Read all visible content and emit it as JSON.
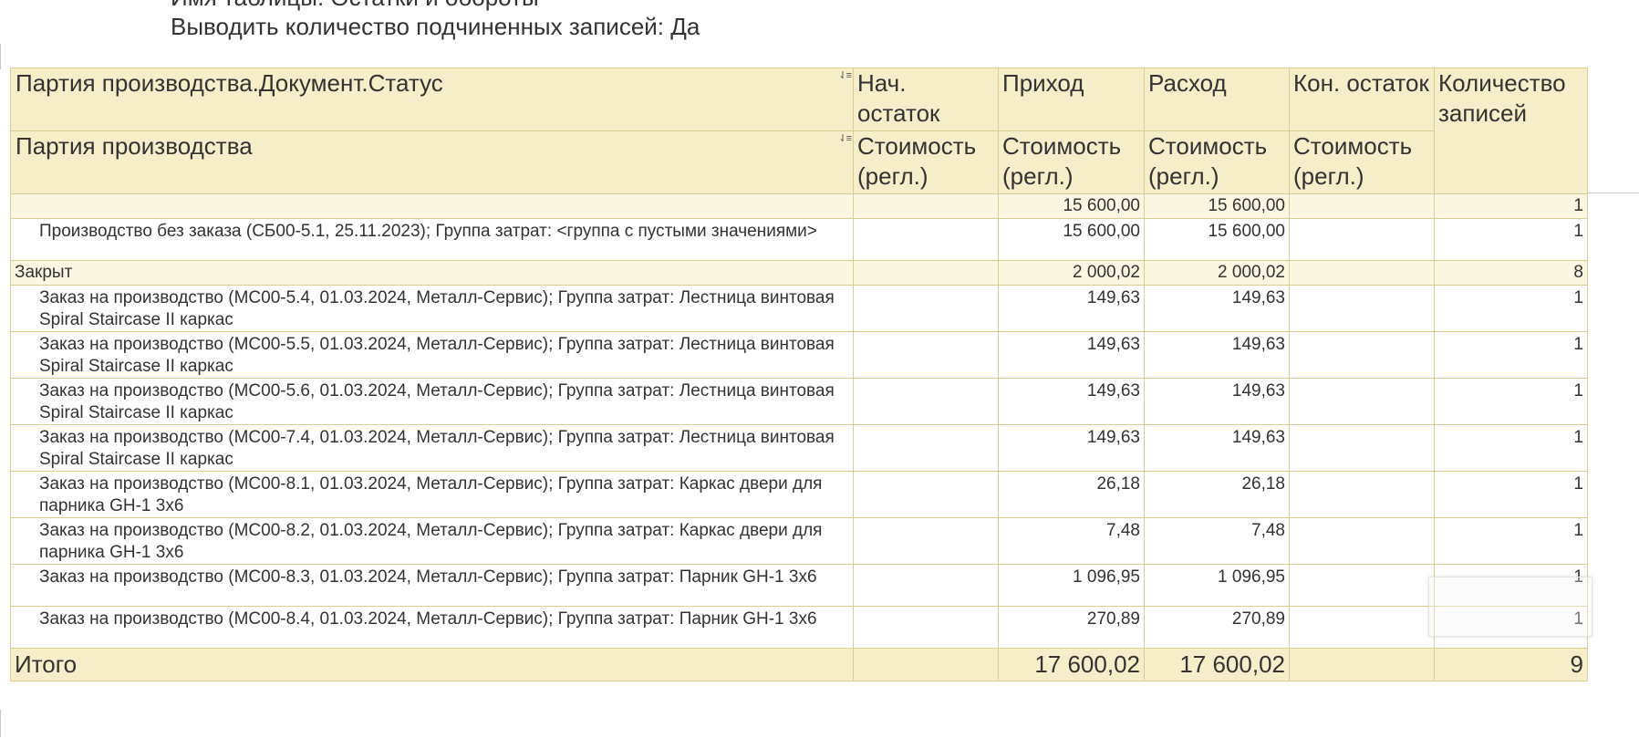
{
  "params": {
    "line1": "Имя таблицы: Остатки и обороты",
    "line2": "Выводить количество подчиненных записей: Да"
  },
  "header": {
    "group1": "Партия производства.Документ.Статус",
    "group2": "Партия производства",
    "col_start_top": "Нач. остаток",
    "col_in_top": "Приход",
    "col_out_top": "Расход",
    "col_end_top": "Кон. остаток",
    "col_count": "Количество записей",
    "sub_value": "Стоимость (регл.)",
    "sort_icon": "sort-icon"
  },
  "rows": [
    {
      "level": "group",
      "name": "",
      "start": "",
      "in": "15 600,00",
      "out": "15 600,00",
      "end": "",
      "count": "1"
    },
    {
      "level": "detail",
      "name": "Производство без заказа (СБ00-5.1, 25.11.2023); Группа затрат: <группа с пустыми значениями>",
      "start": "",
      "in": "15 600,00",
      "out": "15 600,00",
      "end": "",
      "count": "1"
    },
    {
      "level": "group",
      "name": "Закрыт",
      "start": "",
      "in": "2 000,02",
      "out": "2 000,02",
      "end": "",
      "count": "8"
    },
    {
      "level": "detail",
      "name": "Заказ на производство (МС00-5.4, 01.03.2024, Металл-Сервис); Группа затрат: Лестница винтовая Spiral Staircase II каркас",
      "start": "",
      "in": "149,63",
      "out": "149,63",
      "end": "",
      "count": "1"
    },
    {
      "level": "detail",
      "name": "Заказ на производство (МС00-5.5, 01.03.2024, Металл-Сервис); Группа затрат: Лестница винтовая Spiral Staircase II каркас",
      "start": "",
      "in": "149,63",
      "out": "149,63",
      "end": "",
      "count": "1"
    },
    {
      "level": "detail",
      "name": "Заказ на производство (МС00-5.6, 01.03.2024, Металл-Сервис); Группа затрат: Лестница винтовая Spiral Staircase II каркас",
      "start": "",
      "in": "149,63",
      "out": "149,63",
      "end": "",
      "count": "1"
    },
    {
      "level": "detail",
      "name": "Заказ на производство (МС00-7.4, 01.03.2024, Металл-Сервис); Группа затрат: Лестница винтовая Spiral Staircase II каркас",
      "start": "",
      "in": "149,63",
      "out": "149,63",
      "end": "",
      "count": "1"
    },
    {
      "level": "detail",
      "name": "Заказ на производство (МС00-8.1, 01.03.2024, Металл-Сервис); Группа затрат: Каркас двери для парника GH-1 3х6",
      "start": "",
      "in": "26,18",
      "out": "26,18",
      "end": "",
      "count": "1"
    },
    {
      "level": "detail",
      "name": "Заказ на производство (МС00-8.2, 01.03.2024, Металл-Сервис); Группа затрат: Каркас двери для парника GH-1 3х6",
      "start": "",
      "in": "7,48",
      "out": "7,48",
      "end": "",
      "count": "1"
    },
    {
      "level": "detail",
      "name": "Заказ на производство (МС00-8.3, 01.03.2024, Металл-Сервис); Группа затрат: Парник GH-1 3х6",
      "start": "",
      "in": "1 096,95",
      "out": "1 096,95",
      "end": "",
      "count": "1"
    },
    {
      "level": "detail",
      "name": "Заказ на производство (МС00-8.4, 01.03.2024, Металл-Сервис); Группа затрат: Парник GH-1 3х6",
      "start": "",
      "in": "270,89",
      "out": "270,89",
      "end": "",
      "count": "1"
    }
  ],
  "total": {
    "label": "Итого",
    "start": "",
    "in": "17 600,02",
    "out": "17 600,02",
    "end": "",
    "count": "9"
  }
}
